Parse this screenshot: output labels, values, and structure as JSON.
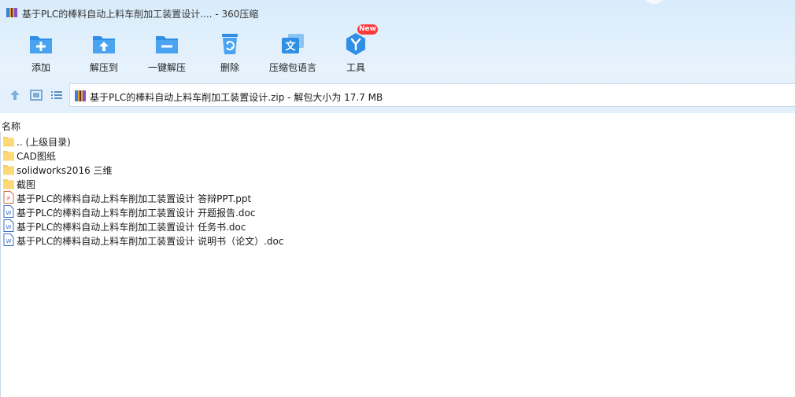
{
  "window": {
    "title": "基于PLC的棒料自动上料车削加工装置设计.... - 360压缩",
    "accent": "#2f8fe6",
    "background_top": "#e3f0fb"
  },
  "toolbar": {
    "items": [
      {
        "label": "添加",
        "icon": "add-icon"
      },
      {
        "label": "解压到",
        "icon": "extract-to-icon"
      },
      {
        "label": "一键解压",
        "icon": "one-click-extract-icon"
      },
      {
        "label": "删除",
        "icon": "delete-icon"
      },
      {
        "label": "压缩包语言",
        "icon": "archive-language-icon"
      },
      {
        "label": "工具",
        "icon": "tools-icon"
      }
    ],
    "new_badge": "New"
  },
  "navbar": {
    "path": "基于PLC的棒料自动上料车削加工装置设计.zip - 解包大小为 17.7 MB"
  },
  "filelist": {
    "column_header": "名称",
    "rows": [
      {
        "name": ".. (上级目录)",
        "type": "folder",
        "icon": "folder-icon"
      },
      {
        "name": "CAD图纸",
        "type": "folder",
        "icon": "folder-icon"
      },
      {
        "name": "solidworks2016 三维",
        "type": "folder",
        "icon": "folder-icon"
      },
      {
        "name": "截图",
        "type": "folder",
        "icon": "folder-icon"
      },
      {
        "name": "基于PLC的棒料自动上料车削加工装置设计 答辩PPT.ppt",
        "type": "ppt",
        "icon": "ppt-file-icon"
      },
      {
        "name": "基于PLC的棒料自动上料车削加工装置设计 开题报告.doc",
        "type": "doc",
        "icon": "doc-file-icon"
      },
      {
        "name": "基于PLC的棒料自动上料车削加工装置设计 任务书.doc",
        "type": "doc",
        "icon": "doc-file-icon"
      },
      {
        "name": "基于PLC的棒料自动上料车削加工装置设计 说明书（论文）.doc",
        "type": "doc",
        "icon": "doc-file-icon"
      }
    ]
  }
}
